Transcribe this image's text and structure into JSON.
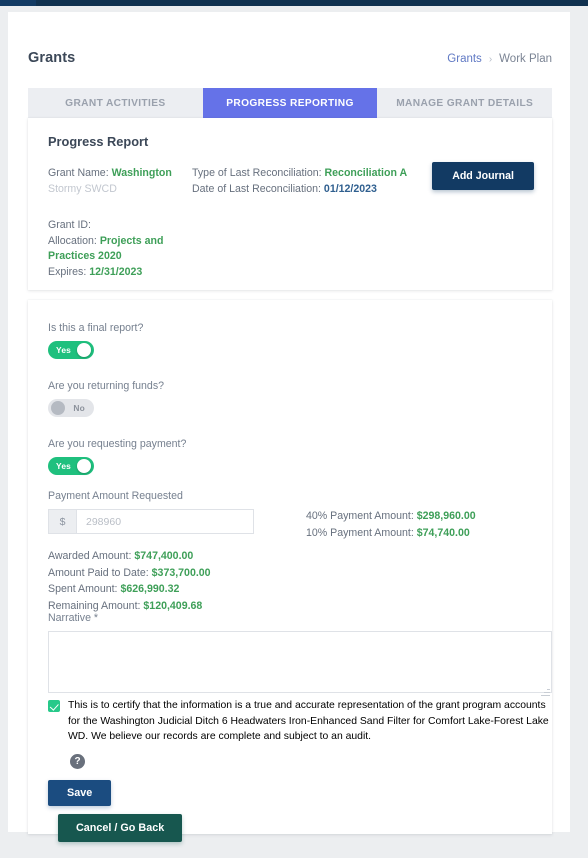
{
  "page": {
    "title": "Grants"
  },
  "breadcrumb": {
    "root": "Grants",
    "separator": "›",
    "current": "Work Plan"
  },
  "tabs": [
    {
      "label": "GRANT ACTIVITIES",
      "active": false
    },
    {
      "label": "PROGRESS REPORTING",
      "active": true
    },
    {
      "label": "MANAGE GRANT DETAILS",
      "active": false
    }
  ],
  "report": {
    "heading": "Progress Report",
    "grant_name_label": "Grant Name:",
    "grant_name_value": "Washington",
    "grant_name_value_2": "Stormy SWCD",
    "grant_id_label": "Grant ID:",
    "grant_id_value": "",
    "allocation_label": "Allocation:",
    "allocation_value": "Projects and Practices 2020",
    "expires_label": "Expires:",
    "expires_value": "12/31/2023",
    "recon_type_label": "Type of Last Reconciliation:",
    "recon_type_value": "Reconciliation A",
    "recon_date_label": "Date of Last Reconciliation:",
    "recon_date_value": "01/12/2023",
    "add_journal_label": "Add Journal"
  },
  "questions": [
    {
      "label": "Is this a final report?",
      "state": "on",
      "state_label": "Yes"
    },
    {
      "label": "Are you returning funds?",
      "state": "off",
      "state_label": "No"
    },
    {
      "label": "Are you requesting payment?",
      "state": "on",
      "state_label": "Yes"
    }
  ],
  "payment": {
    "label": "Payment Amount Requested",
    "currency_prefix": "$",
    "input_value": "298960",
    "input_placeholder": "",
    "pct40_label": "40% Payment Amount:",
    "pct40_value": "$298,960.00",
    "pct10_label": "10% Payment Amount:",
    "pct10_value": "$74,740.00"
  },
  "totals": [
    {
      "label": "Awarded Amount:",
      "value": "$747,400.00"
    },
    {
      "label": "Amount Paid to Date:",
      "value": "$373,700.00"
    },
    {
      "label": "Spent Amount:",
      "value": "$626,990.32"
    },
    {
      "label": "Remaining Amount:",
      "value": "$120,409.68"
    }
  ],
  "narrative": {
    "label": "Narrative *",
    "value": "",
    "placeholder": ""
  },
  "certification": {
    "checked": true,
    "text": "This is to certify that the information is a true and accurate representation of the grant program accounts for the Washington Judicial Ditch 6 Headwaters Iron-Enhanced Sand Filter for Comfort Lake-Forest Lake WD. We believe our records are complete and subject to an audit.",
    "help_glyph": "?"
  },
  "actions": {
    "save_label": "Save",
    "cancel_label": "Cancel / Go Back"
  },
  "colors": {
    "accent_tab": "#6572e8",
    "toggle_on": "#1fc07e",
    "money_green": "#3e9f58",
    "navy": "#123a63",
    "teal": "#17574f",
    "link": "#6079c4"
  }
}
